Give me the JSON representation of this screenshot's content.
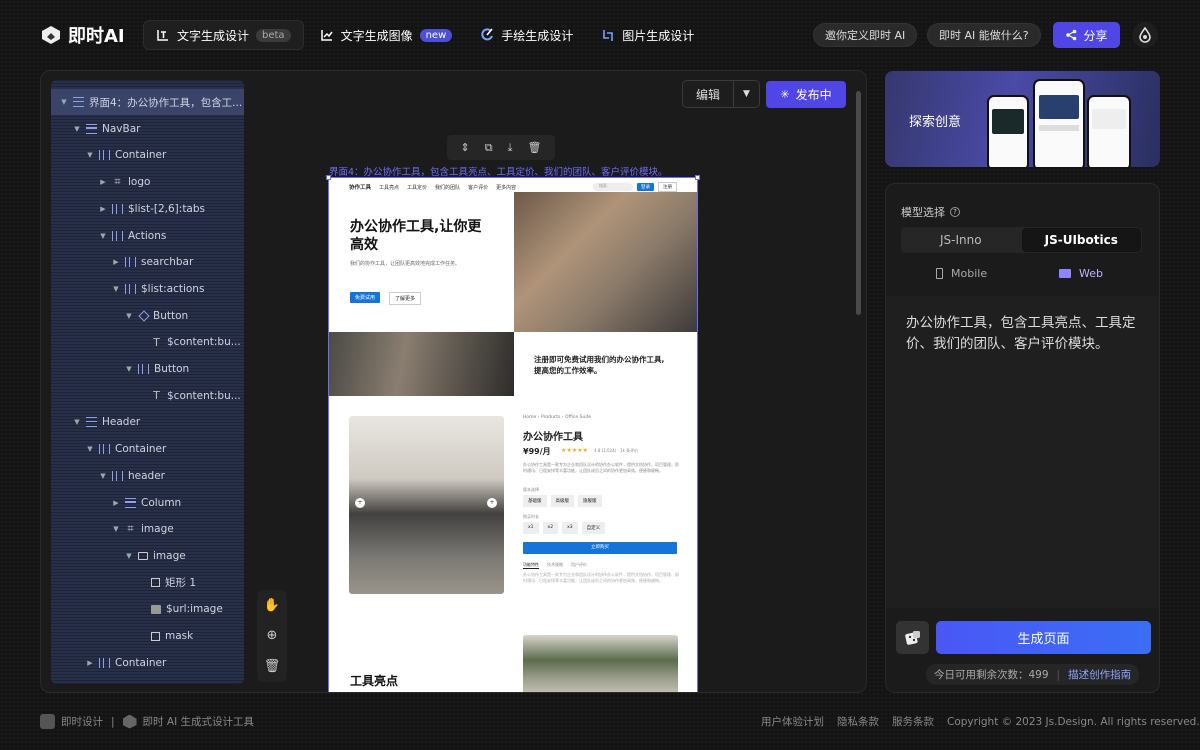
{
  "app": {
    "name": "即时AI"
  },
  "tabs": [
    {
      "label": "文字生成设计",
      "pill": "beta"
    },
    {
      "label": "文字生成图像",
      "pill": "new"
    },
    {
      "label": "手绘生成设计",
      "pill": ""
    },
    {
      "label": "图片生成设计",
      "pill": ""
    }
  ],
  "topright": {
    "define": "邀你定义即时 AI",
    "what": "即时 AI 能做什么?",
    "share": "分享"
  },
  "toolbar": {
    "edit": "编辑",
    "publish": "发布中"
  },
  "frame_label": "界面4：办公协作工具，包含工具亮点、工具定价、我们的团队、客户评价模块。",
  "tree": [
    {
      "label": "界面4：办公协作工具，包含工...",
      "icon": "rows"
    },
    {
      "label": "NavBar",
      "icon": "rows"
    },
    {
      "label": "Container",
      "icon": "col"
    },
    {
      "label": "logo",
      "icon": "hash"
    },
    {
      "label": "$list-[2,6]:tabs",
      "icon": "col"
    },
    {
      "label": "Actions",
      "icon": "col"
    },
    {
      "label": "searchbar",
      "icon": "col"
    },
    {
      "label": "$list:actions",
      "icon": "col"
    },
    {
      "label": "Button",
      "icon": "diamond"
    },
    {
      "label": "$content:bu...",
      "icon": "text"
    },
    {
      "label": "Button",
      "icon": "col"
    },
    {
      "label": "$content:bu...",
      "icon": "text"
    },
    {
      "label": "Header",
      "icon": "rows"
    },
    {
      "label": "Container",
      "icon": "col"
    },
    {
      "label": "header",
      "icon": "col"
    },
    {
      "label": "Column",
      "icon": "rows"
    },
    {
      "label": "image",
      "icon": "hash"
    },
    {
      "label": "image",
      "icon": "folder"
    },
    {
      "label": "矩形 1",
      "icon": "rect"
    },
    {
      "label": "$url:image",
      "icon": "img"
    },
    {
      "label": "mask",
      "icon": "rect"
    },
    {
      "label": "Container",
      "icon": "col"
    }
  ],
  "mock": {
    "nav_brand": "协作工具",
    "nav_links": [
      "工具亮点",
      "工具定价",
      "我们的团队",
      "客户评价",
      "更多内容"
    ],
    "nav_search": "搜索",
    "nav_btn1": "登录",
    "nav_btn2": "注册",
    "hero_title_1": "办公协作工具,让你更",
    "hero_title_2": "高效",
    "hero_desc": "我们的协作工具，让团队更高效地完成工作任务。",
    "hero_btn1": "免费试用",
    "hero_btn2": "了解更多",
    "promo_1": "注册即可免费试用我们的办公协作工具,",
    "promo_2": "提高您的工作效率。",
    "crumb": "Home  ›  Products  ›  Office Suite",
    "product_title": "办公协作工具",
    "price": "¥99/月",
    "rating": "★★★★★",
    "rating_text": "4.8 (1,024)  ·  1k 条评价",
    "desc": "办公协作工具是一款专为企业和团队设计的协作办公软件，提供文档协作、项目管理、即时通讯、日程安排等丰富功能，让团队成员之间的协作更加高效、便捷和顺畅。",
    "opt_label_1": "版本选择",
    "opts1": [
      "基础版",
      "高级版",
      "旗舰版"
    ],
    "opt_label_2": "购买时长",
    "opts2": [
      "x1",
      "x2",
      "x3",
      "自定义"
    ],
    "buy": "立即购买",
    "mini_tabs": [
      "功能特性",
      "技术规格",
      "用户评价"
    ],
    "feature_title": "工具亮点"
  },
  "right": {
    "banner": "探索创意",
    "model_label": "模型选择",
    "models": [
      "JS-Inno",
      "JS-UIbotics"
    ],
    "platforms": [
      "Mobile",
      "Web"
    ],
    "prompt": "办公协作工具，包含工具亮点、工具定价、我们的团队、客户评价模块。",
    "generate": "生成页面",
    "quota": "今日可用剩余次数：499",
    "guide": "描述创作指南"
  },
  "footer": {
    "left1": "即时设计",
    "sep": "|",
    "left2": "即时 AI 生成式设计工具",
    "links": [
      "用户体验计划",
      "隐私条款",
      "服务条款"
    ],
    "copyright": "Copyright © 2023 Js.Design. All rights reserved."
  },
  "colors": {
    "accent": "#4f46e5",
    "tree_bg": "#283049",
    "frame_blue": "#6e6cff",
    "mock_blue": "#1673d8"
  }
}
